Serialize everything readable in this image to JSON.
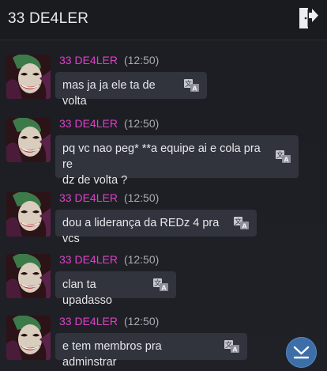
{
  "header": {
    "title": "33 DE4LER",
    "exit_icon": "exit-door-icon"
  },
  "messages": [
    {
      "sender": "33 DE4LER",
      "time": "(12:50)",
      "lines": [
        "mas ja ja ele ta de volta"
      ]
    },
    {
      "sender": "33 DE4LER",
      "time": "(12:50)",
      "lines": [
        "pq vc nao peg* **a equipe ai e cola pra re",
        "dz de volta ?"
      ]
    },
    {
      "sender": "33 DE4LER",
      "time": "(12:50)",
      "lines": [
        "dou a liderança da REDz 4 pra vcs"
      ]
    },
    {
      "sender": "33 DE4LER",
      "time": "(12:50)",
      "lines": [
        "clan ta upadasso"
      ]
    },
    {
      "sender": "33 DE4LER",
      "time": "(12:50)",
      "lines": [
        "e tem membros pra adminstrar"
      ]
    }
  ],
  "icons": {
    "translate": "translate-icon",
    "scroll": "chevron-down-icon"
  },
  "colors": {
    "background": "#1c1e23",
    "bubble": "#31343d",
    "sender": "#e040c8",
    "accent": "#3d6ea8"
  }
}
